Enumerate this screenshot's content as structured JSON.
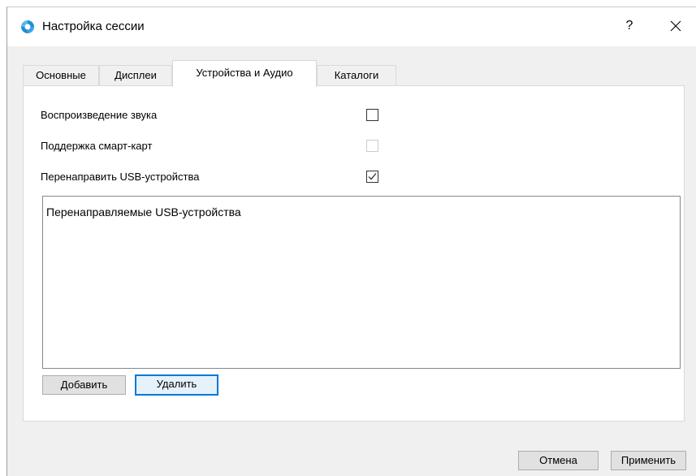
{
  "window": {
    "title": "Настройка сессии",
    "help_label": "?",
    "close_label": "✕"
  },
  "tabs": [
    {
      "label": "Основные",
      "active": false
    },
    {
      "label": "Дисплеи",
      "active": false
    },
    {
      "label": "Устройства и Аудио",
      "active": true
    },
    {
      "label": "Каталоги",
      "active": false
    }
  ],
  "options": [
    {
      "label": "Воспроизведение звука",
      "checked": false,
      "enabled": true
    },
    {
      "label": "Поддержка смарт-карт",
      "checked": false,
      "enabled": false
    },
    {
      "label": "Перенаправить USB-устройства",
      "checked": true,
      "enabled": true
    }
  ],
  "usb_list": {
    "header": "Перенаправляемые USB-устройства",
    "items": []
  },
  "buttons": {
    "add": "Добавить",
    "remove": "Удалить",
    "cancel": "Отмена",
    "apply": "Применить"
  },
  "colors": {
    "accent": "#0078d7",
    "icon_blue": "#1e8fd6",
    "window_bg": "#f0f0f0"
  }
}
